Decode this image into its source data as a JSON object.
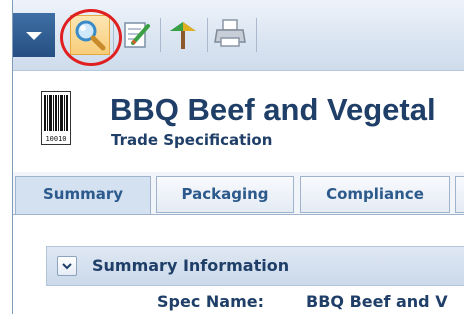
{
  "toolbar": {
    "menu_icon": "chevron-down-icon",
    "buttons": [
      {
        "icon": "search-icon",
        "active": true
      },
      {
        "icon": "edit-icon",
        "active": false
      },
      {
        "icon": "workflow-icon",
        "active": false
      },
      {
        "icon": "printer-icon",
        "active": false
      }
    ]
  },
  "header": {
    "icon": "barcode-icon",
    "barcode_text": "10010",
    "title": "BBQ Beef and Vegetal",
    "subtitle": "Trade Specification"
  },
  "tabs": [
    {
      "label": "Summary",
      "selected": true
    },
    {
      "label": "Packaging",
      "selected": false
    },
    {
      "label": "Compliance",
      "selected": false
    }
  ],
  "section": {
    "title": "Summary Information",
    "collapse_icon": "chevron-down-icon",
    "fields": [
      {
        "label": "Spec Name:",
        "value": "BBQ Beef and V"
      }
    ]
  },
  "colors": {
    "accent": "#2d5a8c",
    "title_text": "#1f3f68",
    "highlight": "#e02020"
  }
}
